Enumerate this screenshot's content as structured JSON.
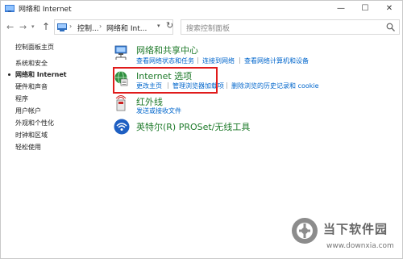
{
  "window": {
    "title": "网络和 Internet",
    "controls": {
      "minimize": "—",
      "maximize": "☐",
      "close": "✕"
    }
  },
  "nav": {
    "back": "←",
    "forward": "→",
    "history_dropdown": "▾",
    "up": "↑",
    "breadcrumbs": [
      "控制...",
      "网络和 Int..."
    ],
    "refresh": "↻",
    "search_placeholder": "搜索控制面板"
  },
  "sidebar": {
    "items": [
      {
        "label": "控制面板主页",
        "active": false
      },
      {
        "label": "系统和安全",
        "active": false
      },
      {
        "label": "网络和 Internet",
        "active": true
      },
      {
        "label": "硬件和声音",
        "active": false
      },
      {
        "label": "程序",
        "active": false
      },
      {
        "label": "用户帐户",
        "active": false
      },
      {
        "label": "外观和个性化",
        "active": false
      },
      {
        "label": "时钟和区域",
        "active": false
      },
      {
        "label": "轻松使用",
        "active": false
      }
    ]
  },
  "categories": [
    {
      "title": "网络和共享中心",
      "icon": "network-sharing-icon",
      "links": [
        "查看网络状态和任务",
        "连接到网络",
        "查看网络计算机和设备"
      ]
    },
    {
      "title": "Internet 选项",
      "icon": "internet-options-icon",
      "links": [
        "更改主页",
        "管理浏览器加载项",
        "删除浏览的历史记录和 cookie"
      ],
      "highlighted": true
    },
    {
      "title": "红外线",
      "icon": "infrared-icon",
      "links": [
        "发送或接收文件"
      ]
    },
    {
      "title": "英特尔(R) PROSet/无线工具",
      "icon": "wireless-icon",
      "links": []
    }
  ],
  "watermark": {
    "name": "当下软件园",
    "url": "www.downxia.com"
  },
  "colors": {
    "category_title": "#1e7a2a",
    "link": "#0066cc",
    "highlight_border": "#e01b1b"
  }
}
